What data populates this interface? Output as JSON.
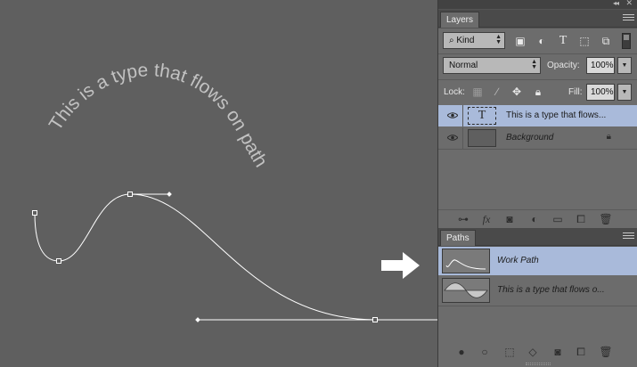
{
  "canvas": {
    "type_on_path_text": "This is a type that flows on path"
  },
  "layers_panel": {
    "tab_label": "Layers",
    "filter_kind": "Kind",
    "blend_mode": "Normal",
    "opacity_label": "Opacity:",
    "opacity_value": "100%",
    "lock_label": "Lock:",
    "fill_label": "Fill:",
    "fill_value": "100%",
    "layers": [
      {
        "name": "This is a type that flows...",
        "kind": "type",
        "selected": true
      },
      {
        "name": "Background",
        "kind": "background",
        "locked": true
      }
    ]
  },
  "paths_panel": {
    "tab_label": "Paths",
    "paths": [
      {
        "name": "Work Path",
        "selected": true
      },
      {
        "name": "This is a type that flows o...",
        "selected": false
      }
    ]
  },
  "colors": {
    "canvas_bg": "#5f5f5f",
    "panel_bg": "#6c6c6c",
    "selection": "#a9bada",
    "path_text": "#c2c2c2"
  }
}
